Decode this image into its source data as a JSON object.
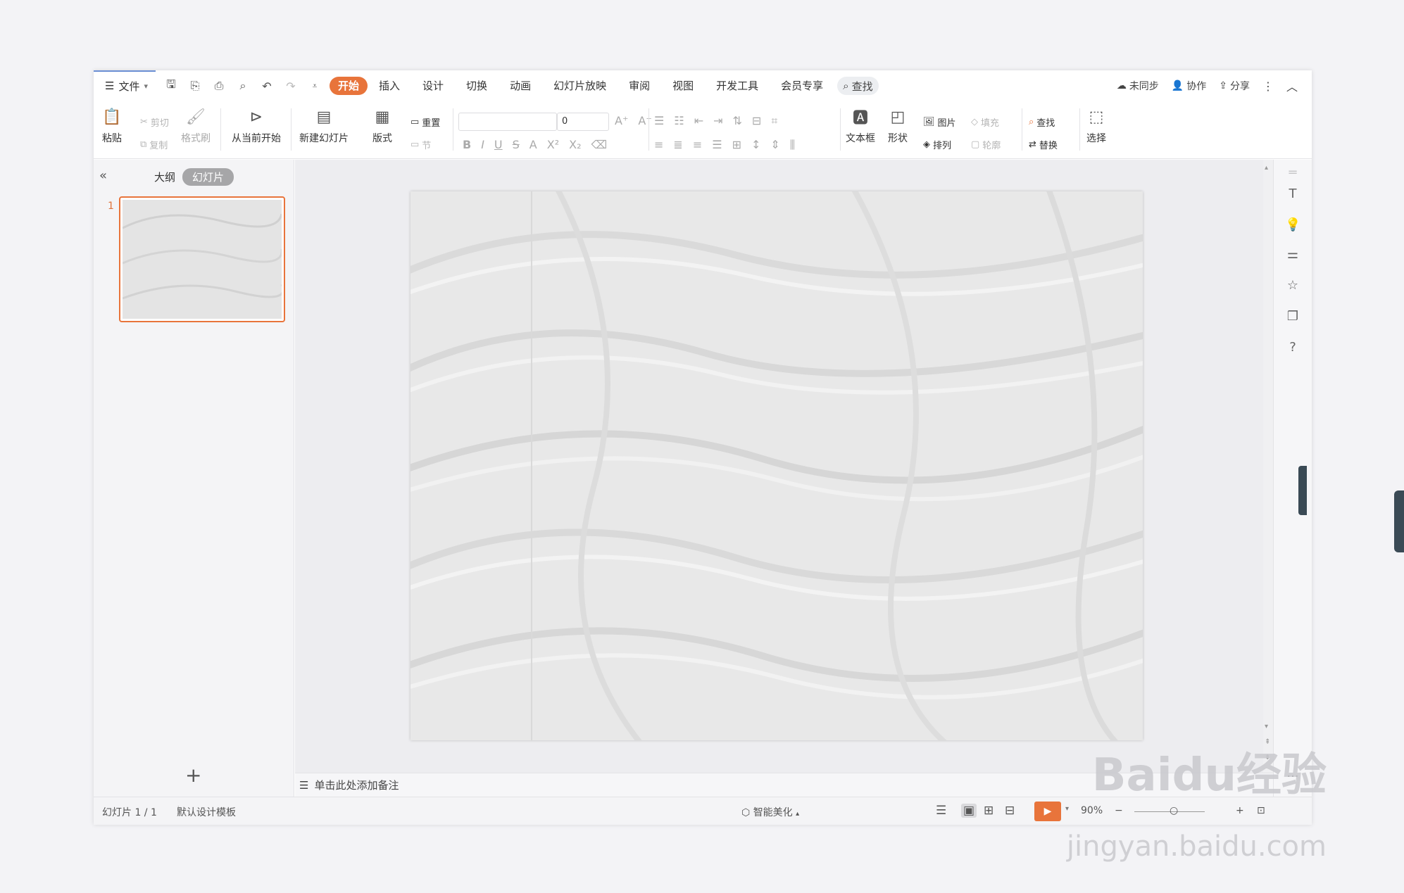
{
  "menu": {
    "file_label": "文件"
  },
  "tabs": [
    {
      "label": "开始",
      "active": true
    },
    {
      "label": "插入"
    },
    {
      "label": "设计"
    },
    {
      "label": "切换"
    },
    {
      "label": "动画"
    },
    {
      "label": "幻灯片放映"
    },
    {
      "label": "审阅"
    },
    {
      "label": "视图"
    },
    {
      "label": "开发工具"
    },
    {
      "label": "会员专享"
    }
  ],
  "search_tab_label": "查找",
  "top_right": {
    "sync_label": "未同步",
    "collab_label": "协作",
    "share_label": "分享"
  },
  "ribbon": {
    "paste": "粘贴",
    "cut": "剪切",
    "copy": "复制",
    "format_painter": "格式刷",
    "from_current": "从当前开始",
    "new_slide": "新建幻灯片",
    "layout": "版式",
    "reset": "重置",
    "section": "节",
    "font_size_value": "0",
    "textbox": "文本框",
    "shape": "形状",
    "picture": "图片",
    "fill": "填充",
    "arrange": "排列",
    "outline": "轮廓",
    "find": "查找",
    "replace": "替换",
    "select": "选择"
  },
  "left_panel": {
    "outline_tab": "大纲",
    "slides_tab": "幻灯片",
    "slide_number": "1"
  },
  "notes_placeholder": "单击此处添加备注",
  "status": {
    "slide_counter": "幻灯片 1 / 1",
    "template": "默认设计模板",
    "smart_beautify": "智能美化",
    "zoom": "90%"
  },
  "watermark": {
    "brand": "Baidu经验",
    "url": "jingyan.baidu.com"
  },
  "colors": {
    "accent": "#e8743b",
    "stage": "#ededf0",
    "slide_texture": "#e9e9e9"
  },
  "icons": [
    "menu-icon",
    "save-icon",
    "undo-icon",
    "redo-icon",
    "print-icon",
    "search-icon",
    "cloud-icon",
    "user-icon",
    "share-icon",
    "more-icon",
    "collapse-icon",
    "play-icon",
    "textbox-icon",
    "lightbulb-icon",
    "sliders-icon",
    "star-icon",
    "layers-icon",
    "help-icon"
  ]
}
